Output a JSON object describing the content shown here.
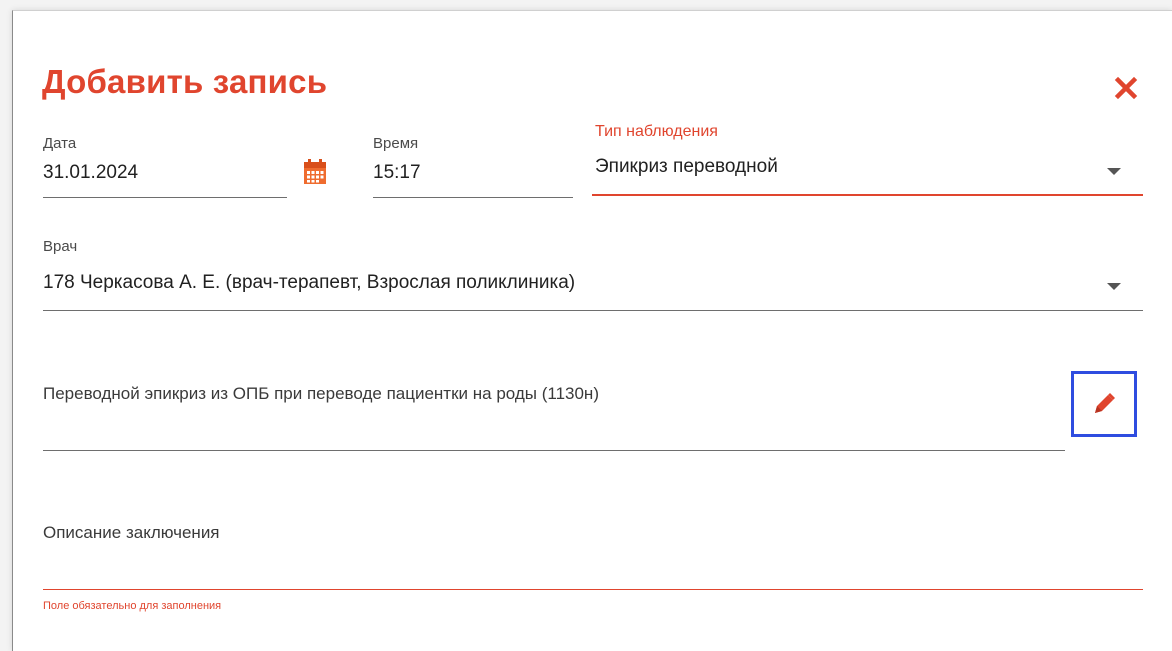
{
  "dialog": {
    "title": "Добавить запись",
    "close_icon": "close-icon",
    "accent_color": "#e0452e"
  },
  "date": {
    "label": "Дата",
    "value": "31.01.2024",
    "icon": "calendar-icon"
  },
  "time": {
    "label": "Время",
    "value": "15:17"
  },
  "observation_type": {
    "label": "Тип наблюдения",
    "value": "Эпикриз переводной",
    "icon": "chevron-down-icon"
  },
  "doctor": {
    "label": "Врач",
    "value": "178 Черкасова А. Е.  (врач-терапевт, Взрослая поликлиника)",
    "icon": "chevron-down-icon"
  },
  "template": {
    "value": "Переводной эпикриз из ОПБ при переводе пациентки на роды (1130н)",
    "edit_icon": "pencil-icon",
    "highlight_color": "#2f4de0"
  },
  "conclusion": {
    "placeholder": "Описание заключения",
    "error": "Поле обязательно для заполнения"
  }
}
